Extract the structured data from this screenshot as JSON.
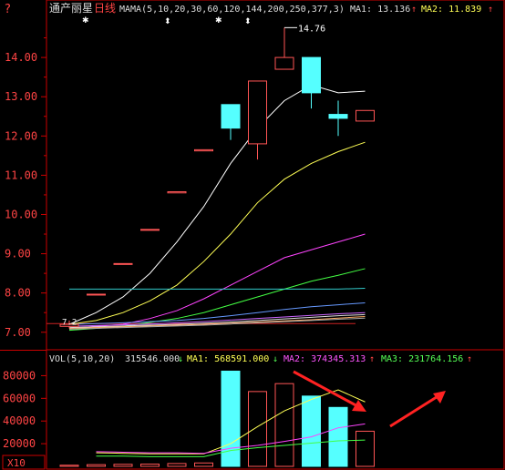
{
  "header": {
    "help_icon_text": "?",
    "stock_name": "通产丽星",
    "period": "日线",
    "mama_text": "MAMA(5,10,20,30,60,120,144,200,250,377,3)",
    "ma1_text": "MA1: 13.136",
    "ma2_text": "MA2: 11.839",
    "up_arrow": "↑"
  },
  "price_axis": {
    "ticks": [
      "14.00",
      "13.00",
      "12.00",
      "11.00",
      "10.00",
      "9.00",
      "8.00",
      "7.00"
    ]
  },
  "annotations": {
    "high_label": "14.76",
    "low_label": "7.2",
    "star": "✱",
    "diamond": "⬍"
  },
  "volume_header": {
    "vol_text": "VOL(5,10,20)",
    "vol_value": "315546.000",
    "ma1_text": "MA1: 568591.000",
    "ma2_text": "MA2: 374345.313",
    "ma3_text": "MA3: 231764.156",
    "down_arrow": "↓",
    "up_arrow": "↑"
  },
  "volume_axis": {
    "ticks": [
      "80000",
      "60000",
      "40000",
      "20000"
    ],
    "unit_label": "X10"
  },
  "chart_data": {
    "type": "candlestick",
    "price_ylim": [
      6.6,
      15.0
    ],
    "volume_ylim": [
      0,
      90000
    ],
    "candles": [
      {
        "open": 7.15,
        "close": 7.2,
        "high": 7.3,
        "low": 7.1,
        "volume": 1000,
        "color": "up"
      },
      {
        "open": 7.95,
        "close": 7.97,
        "high": 7.97,
        "low": 7.95,
        "volume": 1500,
        "color": "up"
      },
      {
        "open": 8.73,
        "close": 8.75,
        "high": 8.75,
        "low": 8.73,
        "volume": 1800,
        "color": "up"
      },
      {
        "open": 9.6,
        "close": 9.62,
        "high": 9.62,
        "low": 9.6,
        "volume": 2000,
        "color": "up"
      },
      {
        "open": 10.55,
        "close": 10.58,
        "high": 10.58,
        "low": 10.55,
        "volume": 2500,
        "color": "up"
      },
      {
        "open": 11.62,
        "close": 11.65,
        "high": 11.65,
        "low": 11.62,
        "volume": 3000,
        "color": "up"
      },
      {
        "open": 12.8,
        "close": 12.2,
        "high": 12.8,
        "low": 11.9,
        "volume": 84000,
        "color": "down"
      },
      {
        "open": 11.8,
        "close": 13.4,
        "high": 13.4,
        "low": 11.4,
        "volume": 66000,
        "color": "up"
      },
      {
        "open": 13.7,
        "close": 14.0,
        "high": 14.76,
        "low": 13.7,
        "volume": 73000,
        "color": "up"
      },
      {
        "open": 14.0,
        "close": 13.1,
        "high": 14.0,
        "low": 12.7,
        "volume": 62000,
        "color": "down"
      },
      {
        "open": 12.55,
        "close": 12.45,
        "high": 12.9,
        "low": 12.0,
        "volume": 52000,
        "color": "down"
      },
      {
        "open": 12.38,
        "close": 12.65,
        "high": 12.65,
        "low": 12.38,
        "volume": 31000,
        "color": "up"
      }
    ],
    "ma_lines": [
      {
        "name": "MA1",
        "color": "#ffffff",
        "values": [
          7.2,
          7.5,
          7.9,
          8.5,
          9.3,
          10.2,
          11.3,
          12.2,
          12.9,
          13.3,
          13.1,
          13.14
        ]
      },
      {
        "name": "MA2",
        "color": "#ffff55",
        "values": [
          7.2,
          7.3,
          7.5,
          7.8,
          8.2,
          8.8,
          9.5,
          10.3,
          10.9,
          11.3,
          11.6,
          11.84
        ]
      },
      {
        "name": "MA",
        "color": "#ff44ff",
        "values": [
          7.1,
          7.15,
          7.2,
          7.35,
          7.55,
          7.85,
          8.2,
          8.55,
          8.9,
          9.1,
          9.3,
          9.5
        ]
      },
      {
        "name": "MA",
        "color": "#44ff44",
        "values": [
          7.05,
          7.1,
          7.15,
          7.25,
          7.35,
          7.5,
          7.7,
          7.9,
          8.1,
          8.3,
          8.45,
          8.62
        ]
      },
      {
        "name": "MA",
        "color": "#33cccc",
        "values": [
          8.1,
          8.1,
          8.1,
          8.1,
          8.1,
          8.1,
          8.1,
          8.1,
          8.1,
          8.1,
          8.1,
          8.12
        ]
      },
      {
        "name": "MA",
        "color": "#6699ff",
        "values": [
          7.2,
          7.22,
          7.24,
          7.27,
          7.3,
          7.35,
          7.42,
          7.5,
          7.58,
          7.65,
          7.7,
          7.75
        ]
      },
      {
        "name": "MA",
        "color": "#cc66ff",
        "values": [
          7.15,
          7.17,
          7.19,
          7.21,
          7.24,
          7.27,
          7.31,
          7.35,
          7.39,
          7.43,
          7.47,
          7.5
        ]
      },
      {
        "name": "MA",
        "color": "#dddddd",
        "values": [
          7.12,
          7.14,
          7.16,
          7.18,
          7.2,
          7.23,
          7.26,
          7.3,
          7.34,
          7.38,
          7.42,
          7.45
        ]
      },
      {
        "name": "MA",
        "color": "#ffaa66",
        "values": [
          7.1,
          7.12,
          7.14,
          7.16,
          7.18,
          7.2,
          7.23,
          7.26,
          7.29,
          7.32,
          7.36,
          7.4
        ]
      },
      {
        "name": "MA",
        "color": "#aaaaaa",
        "values": [
          7.08,
          7.1,
          7.12,
          7.14,
          7.16,
          7.18,
          7.21,
          7.24,
          7.27,
          7.3,
          7.33,
          7.36
        ]
      }
    ],
    "volume_ma_lines": [
      {
        "name": "MA1",
        "color": "#ffff55",
        "values": [
          null,
          12000,
          11500,
          11000,
          11000,
          11000,
          20000,
          35000,
          49000,
          59000,
          67500,
          56859
        ]
      },
      {
        "name": "MA2",
        "color": "#ff44ff",
        "values": [
          null,
          13000,
          12500,
          12000,
          12000,
          11500,
          16000,
          18500,
          22000,
          26000,
          34000,
          37435
        ]
      },
      {
        "name": "MA3",
        "color": "#44ff44",
        "values": [
          null,
          9000,
          9000,
          8500,
          8500,
          8500,
          14000,
          16500,
          18500,
          20500,
          22500,
          23176
        ]
      }
    ],
    "baseline_price": 7.22
  },
  "colors": {
    "up": "#ff5555",
    "down": "#55ffff",
    "axis": "#cc0000",
    "grid": "#660000",
    "text_red": "#ff4444",
    "text_white": "#dddddd",
    "text_yellow": "#ffff55",
    "text_magenta": "#ff55ff",
    "text_green": "#55ff55",
    "arrow": "#ff2222"
  }
}
